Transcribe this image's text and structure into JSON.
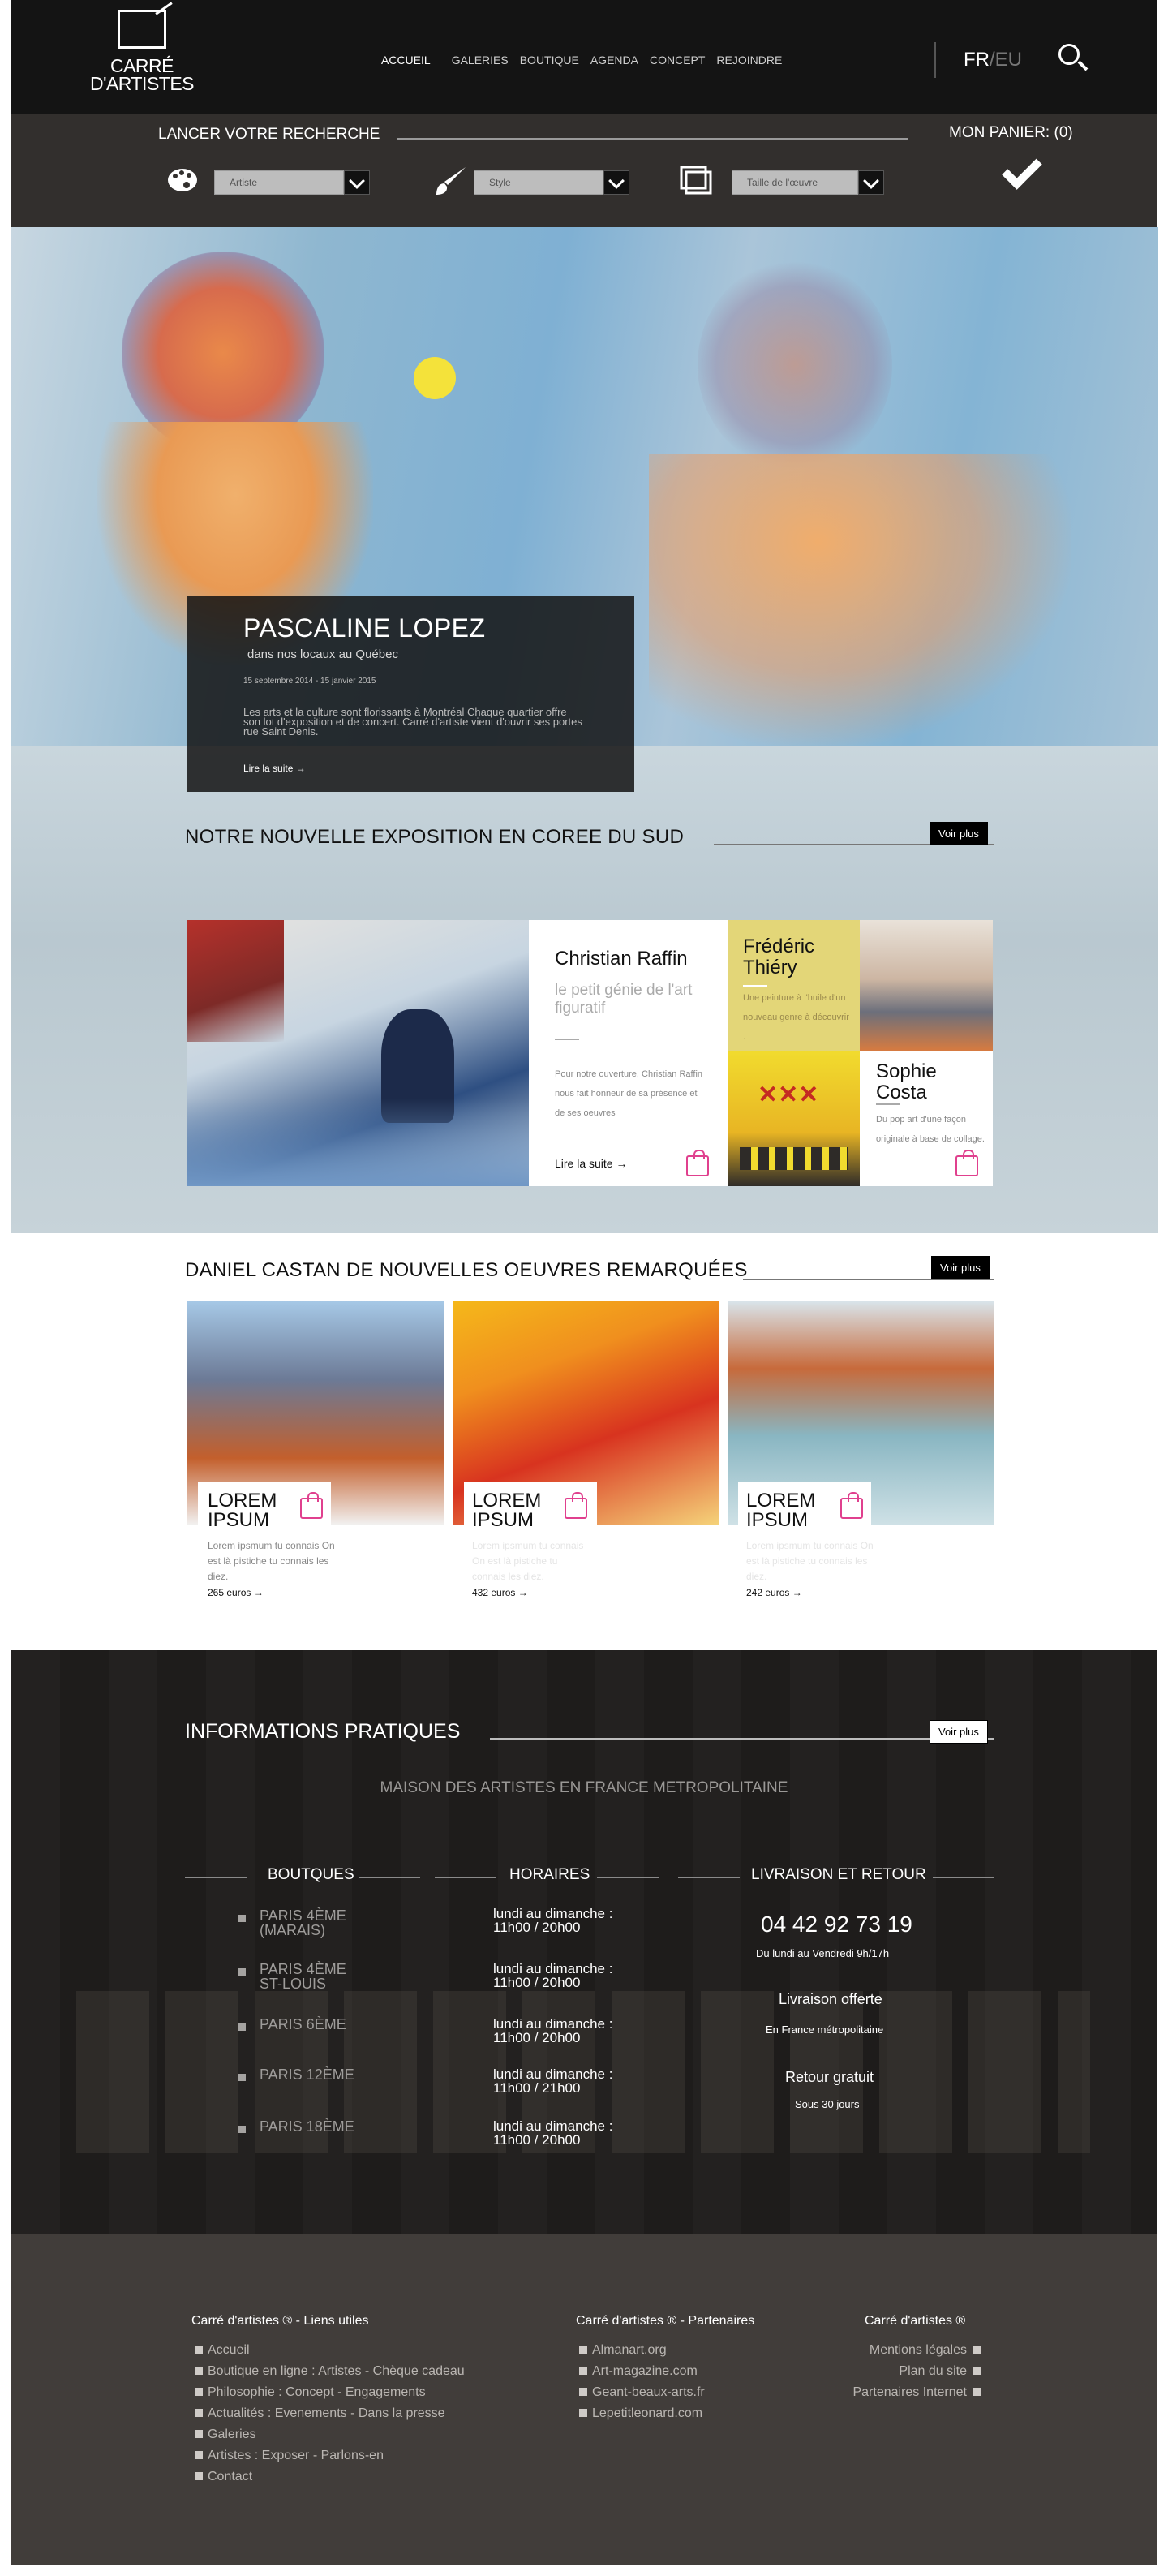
{
  "header": {
    "logo_line1": "CARRÉ",
    "logo_line2": "D'ARTISTES",
    "nav": [
      "ACCUEIL",
      "GALERIES",
      "BOUTIQUE",
      "AGENDA",
      "CONCEPT",
      "REJOINDRE"
    ],
    "lang_active": "FR",
    "lang_sep": "/",
    "lang_other": "EU"
  },
  "search": {
    "title": "LANCER VOTRE RECHERCHE",
    "cart": "MON PANIER: (0)",
    "filter_artist": "Artiste",
    "filter_style": "Style",
    "filter_size": "Taille de l'œuvre"
  },
  "hero": {
    "title": "PASCALINE LOPEZ",
    "subtitle": "dans nos locaux au Québec",
    "date": "15 septembre 2014 - 15 janvier 2015",
    "body": "Les arts et la culture sont florissants à Montréal Chaque quartier offre son lot d'exposition et de concert. Carré d'artiste vient d'ouvrir ses portes rue Saint Denis.",
    "link": "Lire la suite"
  },
  "expo": {
    "title": "NOTRE NOUVELLE EXPOSITION EN COREE DU SUD",
    "more": "Voir plus",
    "artist1": {
      "name": "Christian Raffin",
      "tagline": "le petit génie de l'art figuratif",
      "body": "Pour notre ouverture, Christian Raffin nous fait honneur de sa présence et de ses oeuvres",
      "link": "Lire la suite"
    },
    "artist2": {
      "name": "Frédéric Thiéry",
      "body": "Une peinture à l'huile d'un nouveau genre à découvrir ."
    },
    "artist3": {
      "name": "Sophie Costa",
      "body": "Du pop art d'une façon originale à base de collage."
    }
  },
  "works": {
    "title": "DANIEL CASTAN DE NOUVELLES OEUVRES REMARQUÉES",
    "more": "Voir plus",
    "items": [
      {
        "title": "LOREM IPSUM",
        "body": "Lorem ipsmum tu connais On est là pistiche tu connais les diez.",
        "price": "265 euros"
      },
      {
        "title": "LOREM IPSUM",
        "body": "Lorem ipsmum tu connais On est là pistiche tu connais les diez.",
        "price": "432 euros"
      },
      {
        "title": "LOREM IPSUM",
        "body": "Lorem ipsmum tu connais On est là pistiche tu connais les diez.",
        "price": "242 euros"
      }
    ]
  },
  "info": {
    "title": "INFORMATIONS PRATIQUES",
    "more": "Voir plus",
    "subtitle": "MAISON DES ARTISTES EN FRANCE METROPOLITAINE",
    "col1": "BOUTQUES",
    "col2": "HORAIRES",
    "col3": "LIVRAISON ET RETOUR",
    "shops": [
      "PARIS 4ème (Marais)",
      "PARIS 4ème St-Louis",
      "PARIS 6ème",
      "PARIS 12ème",
      "PARIS 18ème"
    ],
    "hours": [
      "lundi au dimanche : 11h00 / 20h00",
      "lundi au dimanche : 11h00 / 20h00",
      "lundi au dimanche : 11h00 / 20h00",
      "lundi au dimanche : 11h00 / 21h00",
      "lundi au dimanche : 11h00 / 20h00"
    ],
    "phone": "04 42 92 73 19",
    "phone_hours": "Du lundi au Vendredi 9h/17h",
    "delivery_title": "Livraison offerte",
    "delivery_sub": "En France métropolitaine",
    "return_title": "Retour gratuit",
    "return_sub": "Sous 30 jours"
  },
  "footer": {
    "col1_title": "Carré d'artistes ® - Liens utiles",
    "col1": [
      "Accueil",
      "Boutique en ligne : Artistes - Chèque cadeau",
      "Philosophie : Concept - Engagements",
      "Actualités : Evenements - Dans la presse",
      "Galeries",
      "Artistes : Exposer - Parlons-en",
      "Contact"
    ],
    "col2_title": "Carré d'artistes ® - Partenaires",
    "col2": [
      "Almanart.org",
      "Art-magazine.com",
      "Geant-beaux-arts.fr",
      "Lepetitleonard.com"
    ],
    "col3_title": "Carré d'artistes ®",
    "col3": [
      "Mentions légales",
      "Plan du site",
      "Partenaires Internet"
    ]
  }
}
